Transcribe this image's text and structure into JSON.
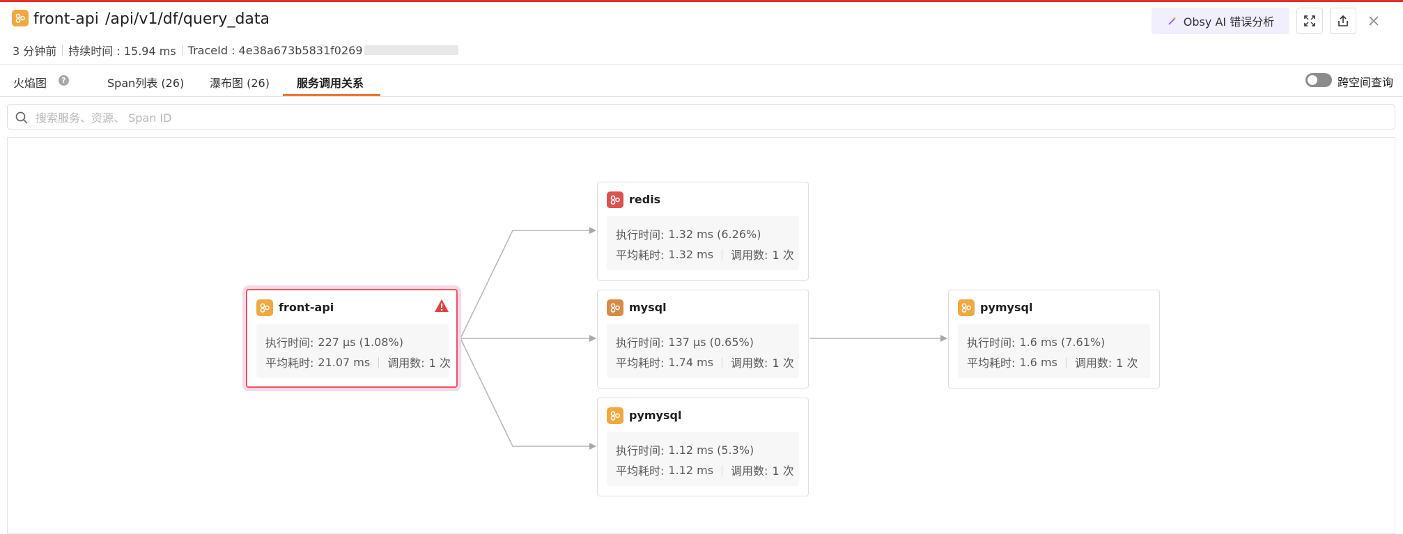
{
  "header": {
    "service": "front-api",
    "path": "/api/v1/df/query_data",
    "time_ago": "3 分钟前",
    "duration": "持续时间 : 15.94 ms",
    "trace_id": "TraceId : 4e38a673b5831f0269",
    "ai_button": "Obsy AI 错误分析"
  },
  "tabs": [
    {
      "label": "火焰图"
    },
    {
      "label": "Span列表 (26)"
    },
    {
      "label": "瀑布图 (26)"
    },
    {
      "label": "服务调用关系"
    }
  ],
  "cross_space": {
    "label": "跨空间查询",
    "enabled": false
  },
  "search": {
    "placeholder": "搜索服务、资源、 Span ID"
  },
  "labels": {
    "exec_time": "执行时间:",
    "avg_time": "平均耗时:",
    "call_count": "调用数:"
  },
  "nodes": [
    {
      "name": "front-api",
      "exec": "227 μs (1.08%)",
      "avg": "21.07 ms",
      "calls": "1 次",
      "error": true,
      "color": "#f0a840"
    },
    {
      "name": "redis",
      "exec": "1.32 ms (6.26%)",
      "avg": "1.32 ms",
      "calls": "1 次",
      "error": false,
      "color": "#d9534f"
    },
    {
      "name": "mysql",
      "exec": "137 μs (0.65%)",
      "avg": "1.74 ms",
      "calls": "1 次",
      "error": false,
      "color": "#d98a45"
    },
    {
      "name": "pymysql",
      "exec": "1.12 ms (5.3%)",
      "avg": "1.12 ms",
      "calls": "1 次",
      "error": false,
      "color": "#f0a840"
    },
    {
      "name": "pymysql",
      "exec": "1.6 ms (7.61%)",
      "avg": "1.6 ms",
      "calls": "1 次",
      "error": false,
      "color": "#f0a840"
    }
  ],
  "colors": {
    "accent": "#f07634",
    "error": "#ec5561",
    "top_line": "#e0312c",
    "ai_bg": "#f1eefe"
  }
}
